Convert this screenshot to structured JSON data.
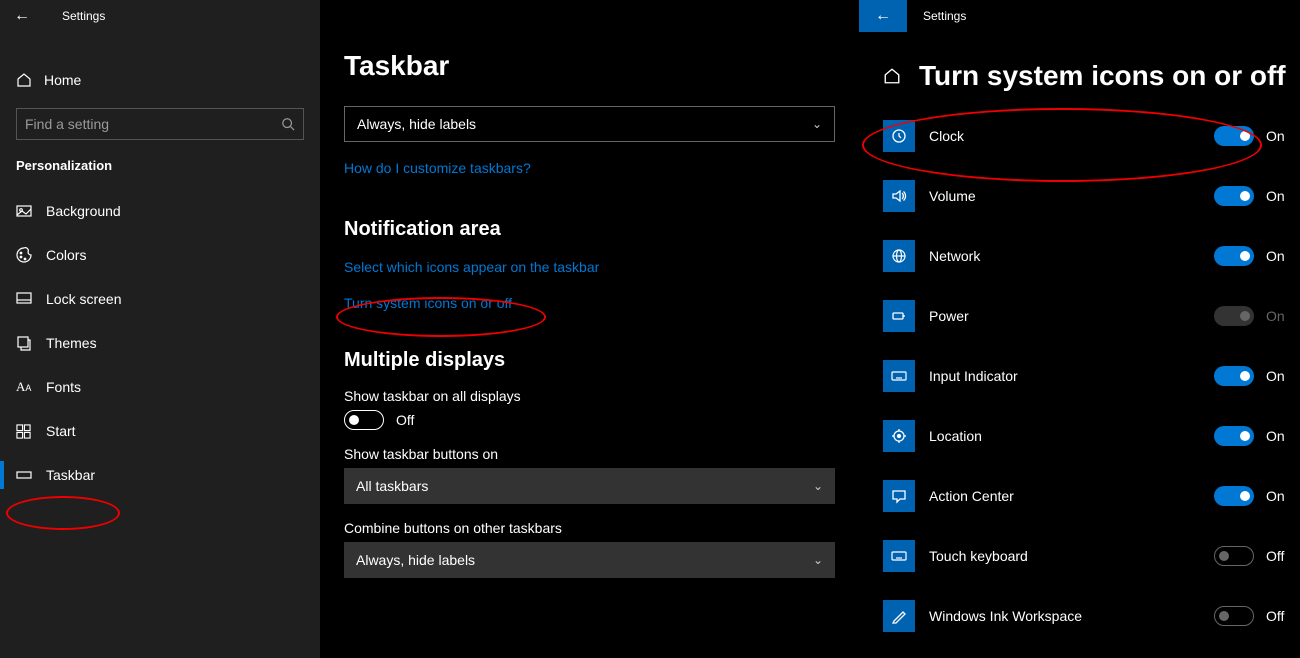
{
  "leftPanel": {
    "titlebar": "Settings",
    "home": "Home",
    "searchPlaceholder": "Find a setting",
    "category": "Personalization",
    "items": [
      {
        "label": "Background",
        "icon": "image"
      },
      {
        "label": "Colors",
        "icon": "palette"
      },
      {
        "label": "Lock screen",
        "icon": "lock"
      },
      {
        "label": "Themes",
        "icon": "themes"
      },
      {
        "label": "Fonts",
        "icon": "fonts"
      },
      {
        "label": "Start",
        "icon": "start"
      },
      {
        "label": "Taskbar",
        "icon": "taskbar",
        "active": true
      }
    ]
  },
  "midPanel": {
    "title": "Taskbar",
    "combineDropdown": "Always, hide labels",
    "helpLink": "How do I customize taskbars?",
    "notifHeader": "Notification area",
    "selectIconsLink": "Select which icons appear on the taskbar",
    "systemIconsLink": "Turn system icons on or off",
    "multiHeader": "Multiple displays",
    "showAllLabel": "Show taskbar on all displays",
    "showAllState": "Off",
    "showButtonsLabel": "Show taskbar buttons on",
    "showButtonsDropdown": "All taskbars",
    "combineOtherLabel": "Combine buttons on other taskbars",
    "combineOtherDropdown": "Always, hide labels"
  },
  "rightPanel": {
    "titlebar": "Settings",
    "header": "Turn system icons on or off",
    "onText": "On",
    "offText": "Off",
    "items": [
      {
        "label": "Clock",
        "state": "on"
      },
      {
        "label": "Volume",
        "state": "on"
      },
      {
        "label": "Network",
        "state": "on"
      },
      {
        "label": "Power",
        "state": "disabled"
      },
      {
        "label": "Input Indicator",
        "state": "on"
      },
      {
        "label": "Location",
        "state": "on"
      },
      {
        "label": "Action Center",
        "state": "on"
      },
      {
        "label": "Touch keyboard",
        "state": "off"
      },
      {
        "label": "Windows Ink Workspace",
        "state": "off"
      }
    ]
  }
}
